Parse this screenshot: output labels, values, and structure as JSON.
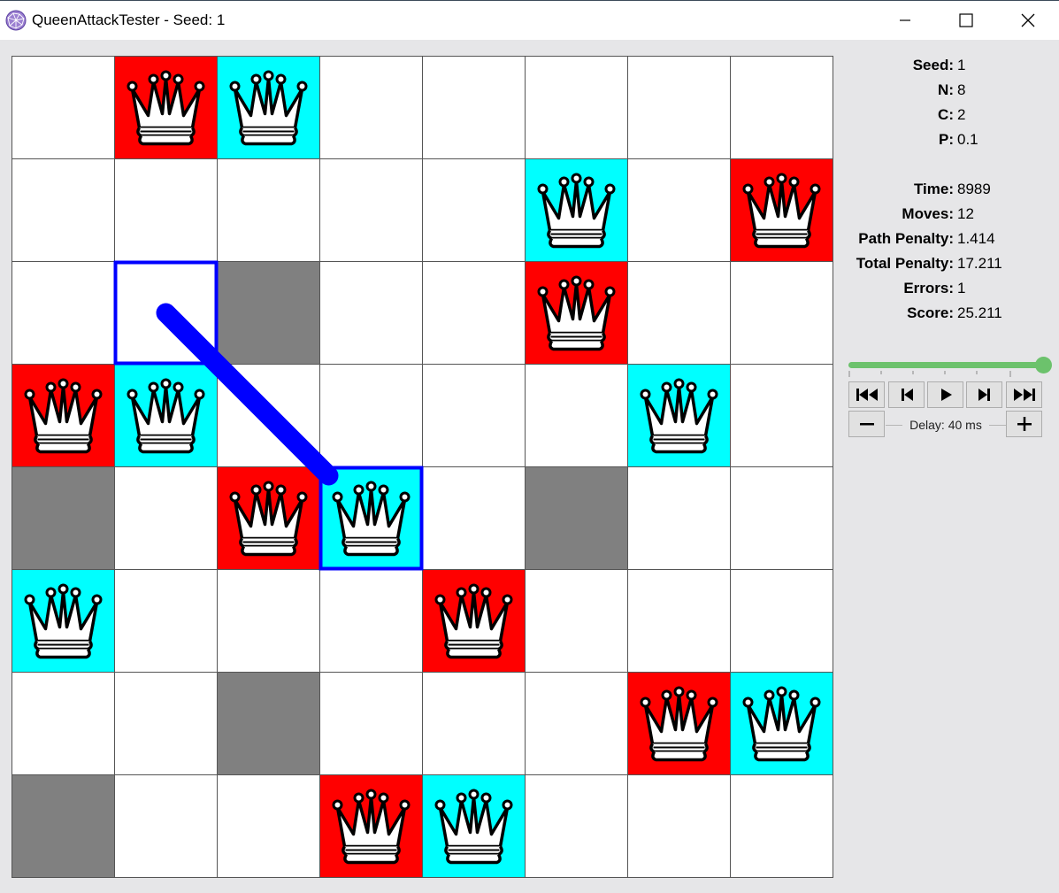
{
  "window": {
    "title": "QueenAttackTester - Seed: 1",
    "icon": "app-globe-icon",
    "controls": [
      "minimize-icon",
      "maximize-icon",
      "close-icon"
    ]
  },
  "board": {
    "n": 8,
    "colors": {
      "empty": "#ffffff",
      "wall": "#808080",
      "red_queen": "#ff0000",
      "cyan_queen": "#00ffff",
      "path": "#0000ff"
    },
    "cells": [
      [
        "empty",
        "red",
        "cyan",
        "empty",
        "empty",
        "empty",
        "empty",
        "empty"
      ],
      [
        "empty",
        "empty",
        "empty",
        "empty",
        "empty",
        "cyan",
        "empty",
        "red"
      ],
      [
        "empty",
        "empty",
        "wall",
        "empty",
        "empty",
        "red",
        "empty",
        "empty"
      ],
      [
        "red",
        "cyan",
        "empty",
        "empty",
        "empty",
        "empty",
        "cyan",
        "empty"
      ],
      [
        "wall",
        "empty",
        "red",
        "cyan",
        "empty",
        "wall",
        "empty",
        "empty"
      ],
      [
        "cyan",
        "empty",
        "empty",
        "empty",
        "red",
        "empty",
        "empty",
        "empty"
      ],
      [
        "empty",
        "empty",
        "wall",
        "empty",
        "empty",
        "empty",
        "red",
        "cyan"
      ],
      [
        "wall",
        "empty",
        "empty",
        "red",
        "cyan",
        "empty",
        "empty",
        "empty"
      ]
    ],
    "last_move": {
      "from": [
        2,
        1
      ],
      "to": [
        4,
        3
      ]
    }
  },
  "stats": [
    {
      "label": "Seed:",
      "value": "1"
    },
    {
      "label": "N:",
      "value": "8"
    },
    {
      "label": "C:",
      "value": "2"
    },
    {
      "label": "P:",
      "value": "0.1"
    },
    {
      "label": "Time:",
      "value": "8989"
    },
    {
      "label": "Moves:",
      "value": "12"
    },
    {
      "label": "Path Penalty:",
      "value": "1.414"
    },
    {
      "label": "Total Penalty:",
      "value": "17.211"
    },
    {
      "label": "Errors:",
      "value": "1"
    },
    {
      "label": "Score:",
      "value": "25.211"
    }
  ],
  "playback": {
    "progress": 1.0,
    "buttons": [
      "skip-to-start-icon",
      "step-back-icon",
      "play-icon",
      "step-forward-icon",
      "skip-to-end-icon"
    ],
    "delay_label": "Delay: 40 ms",
    "decrease_icon": "minus-icon",
    "increase_icon": "plus-icon"
  }
}
